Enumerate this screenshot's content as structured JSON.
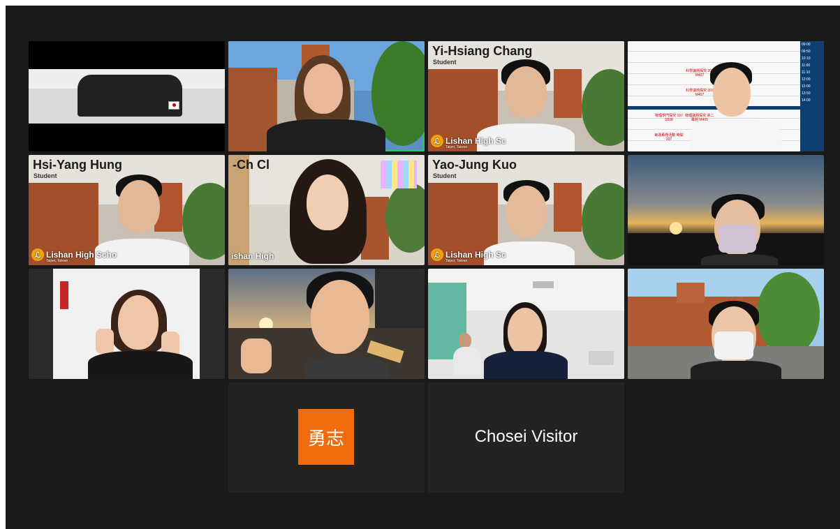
{
  "tiles": [
    {
      "id": "t1",
      "name": "",
      "role": "",
      "school": ""
    },
    {
      "id": "t2",
      "name": "",
      "role": "",
      "school": "",
      "active": true
    },
    {
      "id": "t3",
      "name": "Yi-Hsiang Chang",
      "role": "Student",
      "school": "Lishan High Sc",
      "location": "Taipei, Taiwan"
    },
    {
      "id": "t4",
      "name": "",
      "role": "",
      "school": ""
    },
    {
      "id": "t5",
      "name": "Hsi-Yang Hung",
      "role": "Student",
      "school": "Lishan High Scho",
      "location": "Taipei, Taiwan"
    },
    {
      "id": "t6",
      "name": "-Ch  Cl",
      "role": "",
      "school": "ishan High",
      "location": ""
    },
    {
      "id": "t7",
      "name": "Yao-Jung Kuo",
      "role": "Student",
      "school": "Lishan High Sc",
      "location": "Taipei, Taiwan"
    },
    {
      "id": "t8",
      "name": "",
      "role": "",
      "school": ""
    },
    {
      "id": "t9",
      "name": "",
      "role": "",
      "school": ""
    },
    {
      "id": "t10",
      "name": "",
      "role": "",
      "school": ""
    },
    {
      "id": "t11",
      "name": "",
      "role": "",
      "school": ""
    },
    {
      "id": "t12",
      "name": "",
      "role": "",
      "school": ""
    }
  ],
  "avatar_tile": {
    "avatar_text": "勇志",
    "accent": "#f06c0d"
  },
  "visitor_tile": {
    "label": "Chosei Visitor"
  },
  "schedule": {
    "times": [
      "09:00",
      "09:50",
      "10:10",
      "11:00",
      "11:10",
      "12:00",
      "13:00",
      "13:50",
      "14:00"
    ],
    "cells": [
      "科學議題探究 207 M407",
      "科學議題探究 207 M407",
      "物理學門探究 107 S508",
      "物理議題探究 高二專題 M405",
      "每週專題活動 時間 207"
    ]
  },
  "colors": {
    "active_border": "#33c759",
    "background": "#1a1a1a",
    "tile_bg": "#232323"
  }
}
